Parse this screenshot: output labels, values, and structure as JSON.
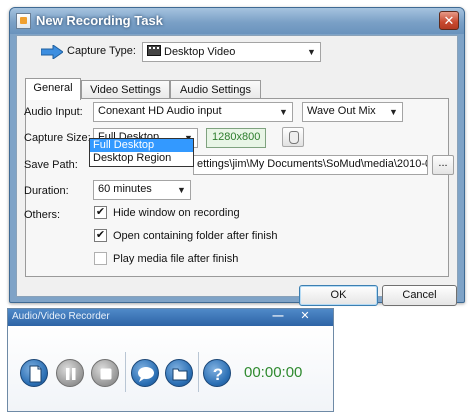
{
  "dialog": {
    "title": "New Recording Task",
    "close_glyph": "✕",
    "capture_type_label": "Capture Type:",
    "capture_type_value": "Desktop Video",
    "tabs": [
      {
        "label": "General",
        "active": true
      },
      {
        "label": "Video Settings",
        "active": false
      },
      {
        "label": "Audio Settings",
        "active": false
      }
    ],
    "audio_input_label": "Audio Input:",
    "audio_input_value": "Conexant HD Audio input",
    "audio_mix_value": "Wave Out Mix",
    "capture_size_label": "Capture Size:",
    "capture_size_value": "Full Desktop",
    "resolution": "1280x800",
    "capture_size_options": [
      "Full Desktop",
      "Desktop Region"
    ],
    "save_path_label": "Save Path:",
    "save_path_value": "ettings\\jim\\My Documents\\SoMud\\media\\2010-0",
    "browse_label": "...",
    "duration_label": "Duration:",
    "duration_value": "60 minutes",
    "others_label": "Others:",
    "options": [
      {
        "label": "Hide window on recording",
        "checked": true
      },
      {
        "label": "Open containing folder after finish",
        "checked": true
      },
      {
        "label": "Play media file after finish",
        "checked": false
      }
    ],
    "ok_label": "OK",
    "cancel_label": "Cancel"
  },
  "recorder": {
    "title": "Audio/Video Recorder",
    "minimize_glyph": "—",
    "close_glyph": "✕",
    "help_glyph": "?",
    "timer": "00:00:00"
  },
  "icons": [
    "dialog-app-icon",
    "arrow-icon",
    "film-icon",
    "hand-icon",
    "document-icon",
    "pause-icon",
    "stop-icon",
    "chat-icon",
    "folder-icon",
    "help-icon"
  ],
  "colors": {
    "titlebar": "#7aa0c6",
    "resolution_text": "#2d7d2d",
    "timer": "#2f8a2f",
    "recorder_title": "#2e64a6",
    "selection": "#3399ff"
  }
}
